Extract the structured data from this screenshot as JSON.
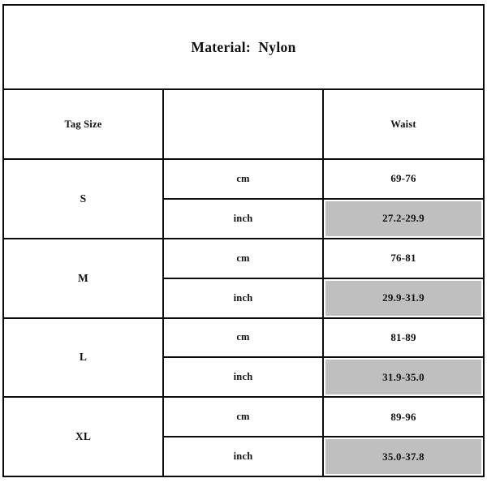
{
  "title": "Material:  Nylon",
  "columns": {
    "tag_size": "Tag Size",
    "unit": "",
    "waist": "Waist"
  },
  "units": {
    "cm": "cm",
    "inch": "inch"
  },
  "colors": {
    "border": "#0b0b0b",
    "highlight": "#bfbfbf",
    "background": "#ffffff",
    "text": "#111111"
  },
  "rows": [
    {
      "tag_size": "S",
      "cm": "69-76",
      "inch": "27.2-29.9"
    },
    {
      "tag_size": "M",
      "cm": "76-81",
      "inch": "29.9-31.9"
    },
    {
      "tag_size": "L",
      "cm": "81-89",
      "inch": "31.9-35.0"
    },
    {
      "tag_size": "XL",
      "cm": "89-96",
      "inch": "35.0-37.8"
    }
  ],
  "chart_data": {
    "type": "table",
    "title": "Material:  Nylon",
    "columns": [
      "Tag Size",
      "",
      "Waist"
    ],
    "categories": [
      "S",
      "M",
      "L",
      "XL"
    ],
    "series": [
      {
        "name": "Waist (cm)",
        "values": [
          "69-76",
          "76-81",
          "81-89",
          "89-96"
        ]
      },
      {
        "name": "Waist (inch)",
        "values": [
          "27.2-29.9",
          "29.9-31.9",
          "31.9-35.0",
          "35.0-37.8"
        ]
      }
    ],
    "highlighted_rows": [
      "inch"
    ],
    "grid": true,
    "legend": "none"
  }
}
